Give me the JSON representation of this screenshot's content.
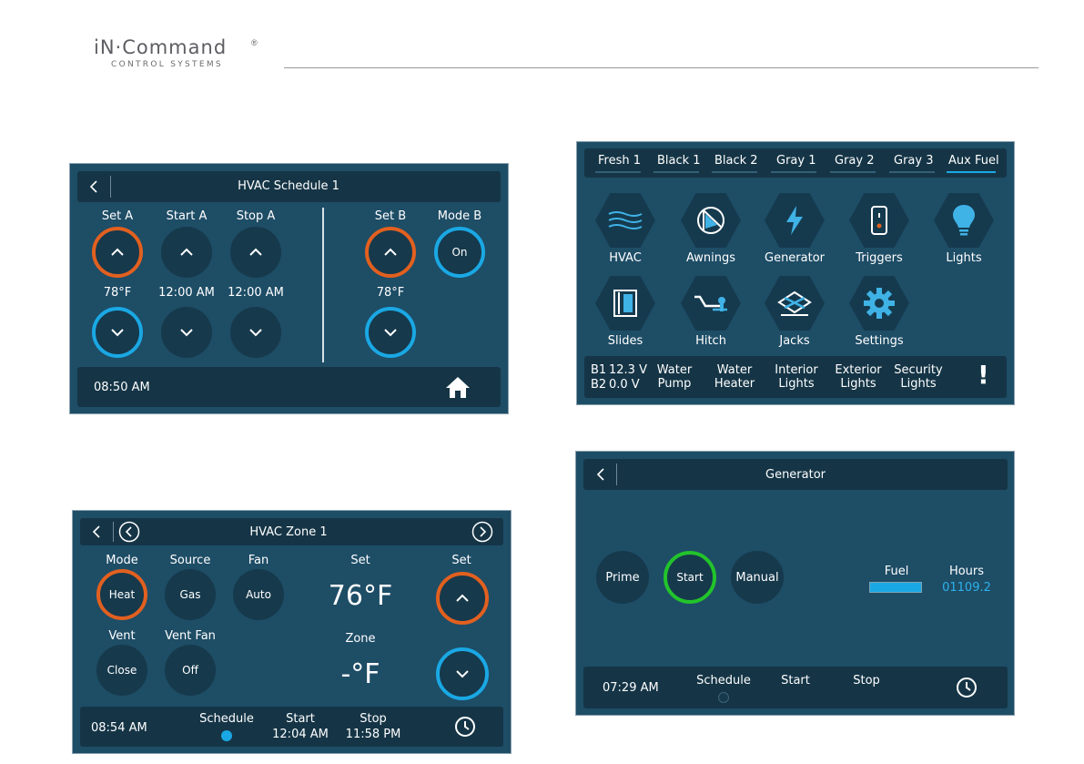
{
  "brand": {
    "logo_main": "iN·Command",
    "logo_sub": "CONTROL SYSTEMS",
    "registered": "®"
  },
  "colors": {
    "panel_bg": "#1e4d66",
    "bar_bg": "#153546",
    "ring_orange": "#e2601f",
    "ring_blue": "#1aa8e4",
    "ring_green": "#22c32b"
  },
  "hvac_schedule": {
    "title": "HVAC Schedule 1",
    "labels": {
      "set_a": "Set A",
      "start_a": "Start A",
      "stop_a": "Stop A",
      "set_b": "Set B",
      "mode_b": "Mode B"
    },
    "values": {
      "set_a": "78°F",
      "start_a": "12:00 AM",
      "stop_a": "12:00 AM",
      "set_b": "78°F"
    },
    "mode_b_button": "On",
    "time": "08:50 AM",
    "icons": {
      "back": "back-chevron-icon",
      "home": "home-icon"
    }
  },
  "hvac_zone": {
    "title": "HVAC Zone 1",
    "labels": {
      "mode": "Mode",
      "source": "Source",
      "fan": "Fan",
      "set_center": "Set",
      "set_right": "Set",
      "vent": "Vent",
      "vent_fan": "Vent Fan",
      "zone": "Zone"
    },
    "buttons": {
      "mode": "Heat",
      "source": "Gas",
      "fan": "Auto",
      "vent": "Close",
      "vent_fan": "Off"
    },
    "set_temp": "76°F",
    "zone_temp": "-°F",
    "footer": {
      "time": "08:54 AM",
      "schedule": "Schedule",
      "start_label": "Start",
      "start_value": "12:04 AM",
      "stop_label": "Stop",
      "stop_value": "11:58 PM"
    },
    "icons": {
      "back": "back-chevron-icon",
      "prev": "circle-left-icon",
      "next": "circle-right-icon",
      "clock": "clock-icon"
    }
  },
  "main_menu": {
    "tabs": [
      "Fresh 1",
      "Black 1",
      "Black 2",
      "Gray 1",
      "Gray 2",
      "Gray 3",
      "Aux Fuel"
    ],
    "active_tab": "Aux Fuel",
    "tiles": [
      {
        "label": "HVAC",
        "icon": "hvac-waves-icon"
      },
      {
        "label": "Awnings",
        "icon": "awning-icon"
      },
      {
        "label": "Generator",
        "icon": "lightning-icon"
      },
      {
        "label": "Triggers",
        "icon": "switch-icon"
      },
      {
        "label": "Lights",
        "icon": "lightbulb-icon"
      },
      {
        "label": "Slides",
        "icon": "slide-out-icon"
      },
      {
        "label": "Hitch",
        "icon": "hitch-icon"
      },
      {
        "label": "Jacks",
        "icon": "jack-icon"
      },
      {
        "label": "Settings",
        "icon": "gear-icon"
      }
    ],
    "battery": {
      "b1_label": "B1",
      "b1_value": "12.3 V",
      "b2_label": "B2",
      "b2_value": "0.0 V"
    },
    "quick": [
      {
        "line1": "Water",
        "line2": "Pump"
      },
      {
        "line1": "Water",
        "line2": "Heater"
      },
      {
        "line1": "Interior",
        "line2": "Lights"
      },
      {
        "line1": "Exterior",
        "line2": "Lights"
      },
      {
        "line1": "Security",
        "line2": "Lights"
      }
    ],
    "alert": "!"
  },
  "generator": {
    "title": "Generator",
    "buttons": {
      "prime": "Prime",
      "start": "Start",
      "manual": "Manual"
    },
    "fuel_label": "Fuel",
    "fuel_level": 1.0,
    "hours_label": "Hours",
    "hours_value": "01109.2",
    "footer": {
      "time": "07:29 AM",
      "schedule": "Schedule",
      "start": "Start",
      "stop": "Stop"
    },
    "icons": {
      "back": "back-chevron-icon",
      "clock": "clock-icon"
    }
  }
}
